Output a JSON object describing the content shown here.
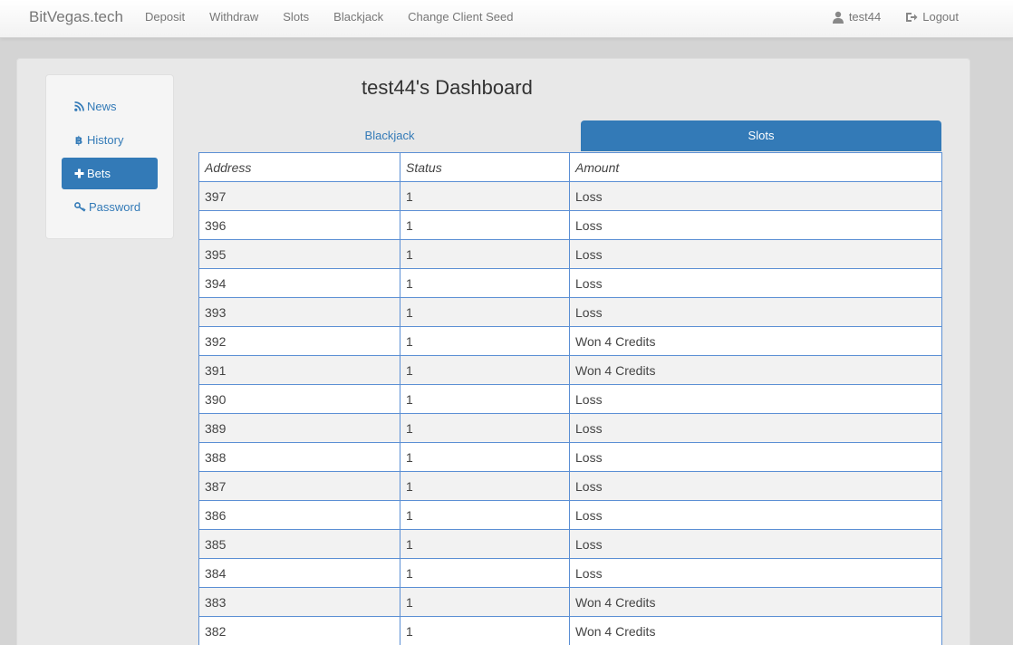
{
  "navbar": {
    "brand": "BitVegas.tech",
    "links": [
      "Deposit",
      "Withdraw",
      "Slots",
      "Blackjack",
      "Change Client Seed"
    ],
    "user": "test44",
    "logout": "Logout"
  },
  "sidebar": {
    "items": [
      {
        "label": "News",
        "icon": "rss-icon",
        "active": false
      },
      {
        "label": "History",
        "icon": "bitcoin-icon",
        "active": false
      },
      {
        "label": "Bets",
        "icon": "plus-icon",
        "active": true
      },
      {
        "label": "Password",
        "icon": "key-icon",
        "active": false
      }
    ]
  },
  "page": {
    "title": "test44's Dashboard"
  },
  "tabs": {
    "blackjack": "Blackjack",
    "slots": "Slots"
  },
  "table": {
    "headers": [
      "Address",
      "Status",
      "Amount"
    ],
    "rows": [
      [
        "397",
        "1",
        "Loss"
      ],
      [
        "396",
        "1",
        "Loss"
      ],
      [
        "395",
        "1",
        "Loss"
      ],
      [
        "394",
        "1",
        "Loss"
      ],
      [
        "393",
        "1",
        "Loss"
      ],
      [
        "392",
        "1",
        "Won 4 Credits"
      ],
      [
        "391",
        "1",
        "Won 4 Credits"
      ],
      [
        "390",
        "1",
        "Loss"
      ],
      [
        "389",
        "1",
        "Loss"
      ],
      [
        "388",
        "1",
        "Loss"
      ],
      [
        "387",
        "1",
        "Loss"
      ],
      [
        "386",
        "1",
        "Loss"
      ],
      [
        "385",
        "1",
        "Loss"
      ],
      [
        "384",
        "1",
        "Loss"
      ],
      [
        "383",
        "1",
        "Won 4 Credits"
      ],
      [
        "382",
        "1",
        "Won 4 Credits"
      ]
    ]
  },
  "colors": {
    "accent": "#337ab7",
    "table_border": "#5b8fd4"
  }
}
